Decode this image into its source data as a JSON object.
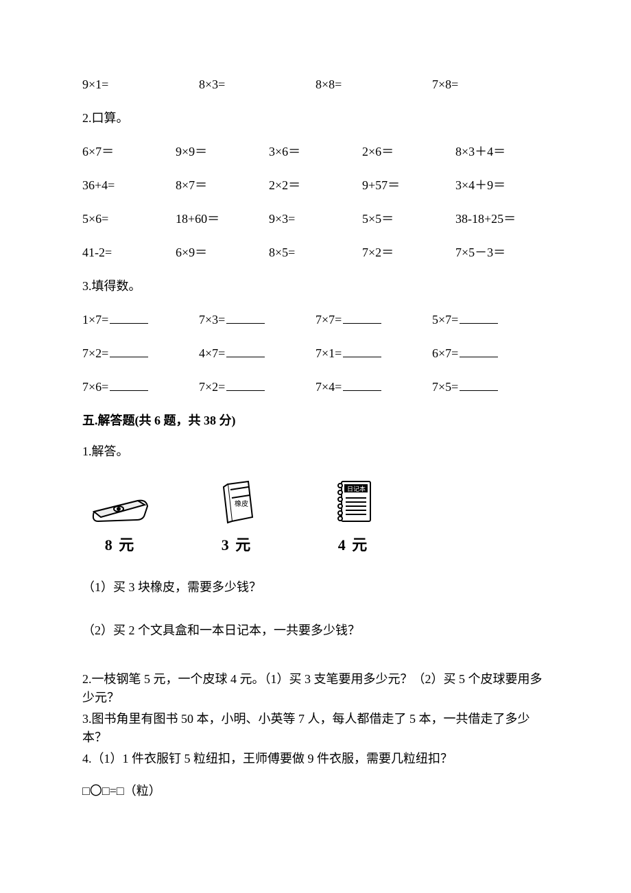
{
  "arith_row1": [
    "9×1=",
    "8×3=",
    "8×8=",
    "7×8="
  ],
  "sec2_title": "2.口算。",
  "sec2_rows": [
    [
      "6×7＝",
      "9×9＝",
      "3×6＝",
      "2×6＝",
      "8×3＋4＝"
    ],
    [
      "36+4=",
      "8×7＝",
      "2×2＝",
      "9+57＝",
      "3×4＋9＝"
    ],
    [
      "5×6=",
      "18+60＝",
      "9×3=",
      "5×5＝",
      "38-18+25＝"
    ],
    [
      "41-2=",
      "6×9＝",
      "8×5=",
      "7×2＝",
      "7×5－3＝"
    ]
  ],
  "sec3_title": "3.填得数。",
  "sec3_rows": [
    [
      "1×7=",
      "7×3=",
      "7×7=",
      "5×7="
    ],
    [
      "7×2=",
      "4×7=",
      "7×1=",
      "6×7="
    ],
    [
      "7×6=",
      "7×2=",
      "7×4=",
      "7×5="
    ]
  ],
  "section5_heading": "五.解答题(共 6 题，共 38 分)",
  "q1_title": "1.解答。",
  "items": [
    {
      "price": "8 元"
    },
    {
      "price": "3 元"
    },
    {
      "price": "4 元"
    }
  ],
  "q1_sub1": "（1）买 3 块橡皮，需要多少钱？",
  "q1_sub2": "（2）买 2 个文具盒和一本日记本，一共要多少钱？",
  "q2": "2.一枝钢笔 5 元，一个皮球 4 元。（1）买 3 支笔要用多少元？（2）买 5 个皮球要用多少元？",
  "q3": "3.图书角里有图书 50 本，小明、小英等 7 人，每人都借走了 5 本，一共借走了多少本？",
  "q4": "4.（1）1 件衣服钉 5 粒纽扣，王师傅要做 9 件衣服，需要几粒纽扣？",
  "q4_formula": "□〇□=□（粒）"
}
